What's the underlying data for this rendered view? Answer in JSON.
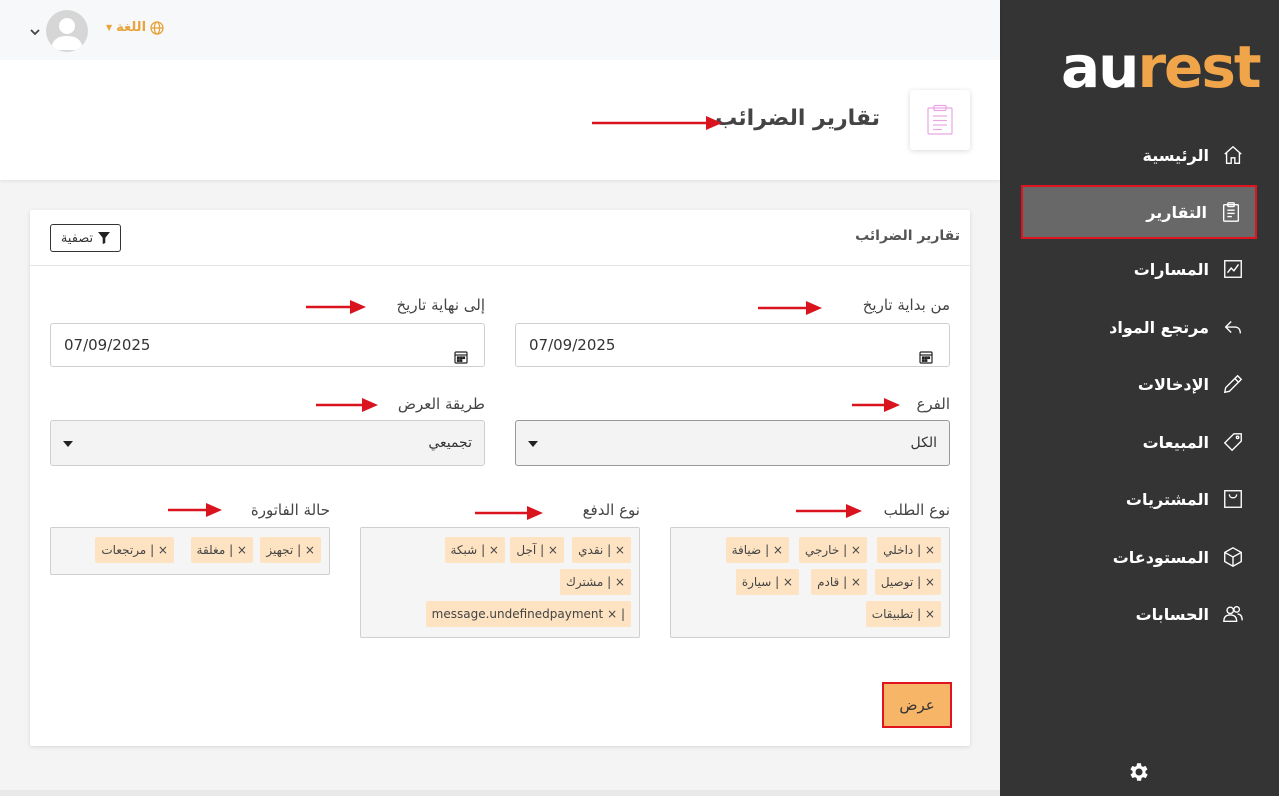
{
  "sidebar": {
    "logo_au": "au",
    "logo_rest": "rest",
    "items": [
      {
        "label": "الرئيسية",
        "icon": "home-icon"
      },
      {
        "label": "التقارير",
        "icon": "clipboard-icon"
      },
      {
        "label": "المسارات",
        "icon": "chart-line-icon"
      },
      {
        "label": "مرتجع المواد",
        "icon": "reply-arrow-icon"
      },
      {
        "label": "الإدخالات",
        "icon": "pencil-icon"
      },
      {
        "label": "المبيعات",
        "icon": "tag-icon"
      },
      {
        "label": "المشتريات",
        "icon": "bag-icon"
      },
      {
        "label": "المستودعات",
        "icon": "box-icon"
      },
      {
        "label": "الحسابات",
        "icon": "users-icon"
      }
    ],
    "active_index": 1
  },
  "topbar": {
    "language_label": "اللغة"
  },
  "page": {
    "title": "تقارير الضرائب"
  },
  "card": {
    "title": "تقارير الضرائب",
    "filter_label": "تصفية",
    "from_date_label": "من بداية تاريخ",
    "from_date_value": "07/09/2025",
    "to_date_label": "إلى نهاية تاريخ",
    "to_date_value": "07/09/2025",
    "branch_label": "الفرع",
    "branch_value": "الكل",
    "display_label": "طريقة العرض",
    "display_value": "تجميعي",
    "order_type_label": "نوع الطلب",
    "order_type_tags": [
      "داخلي",
      "خارجي",
      "ضيافة",
      "توصيل",
      "قادم",
      "سيارة",
      "تطبيقات"
    ],
    "payment_type_label": "نوع الدفع",
    "payment_type_tags": [
      "نقدي",
      "آجل",
      "شبكة",
      "مشترك",
      "message.undefinedpayment"
    ],
    "invoice_status_label": "حالة الفاتورة",
    "invoice_status_tags": [
      "تجهيز",
      "مغلقة",
      "مرتجعات"
    ],
    "tag_remove_glyph": "× |",
    "show_label": "عرض"
  },
  "colors": {
    "sidebar_bg": "#343434",
    "accent": "#f0a54a",
    "tag_bg": "#fde3c2",
    "highlight_border": "#e0141f",
    "arrow": "#d9141f"
  }
}
